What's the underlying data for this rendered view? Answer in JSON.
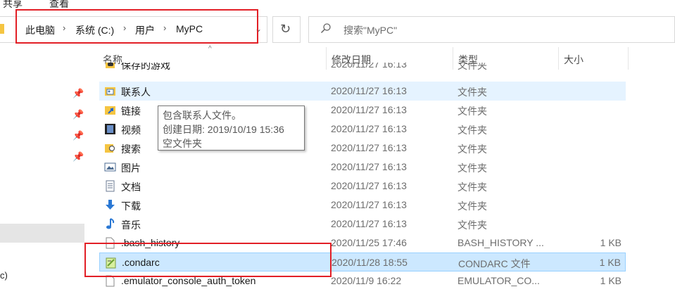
{
  "menu": {
    "items": [
      "共享",
      "查看"
    ]
  },
  "address": {
    "crumbs": [
      "此电脑",
      "系统 (C:)",
      "用户",
      "MyPC"
    ]
  },
  "search": {
    "placeholder": "搜索\"MyPC\""
  },
  "headers": {
    "name": "名称",
    "date": "修改日期",
    "type": "类型",
    "size": "大小"
  },
  "rows": [
    {
      "name": "保存的游戏",
      "date": "2020/11/27 16:13",
      "type": "文件夹",
      "size": "",
      "icon": "saved-games-icon"
    },
    {
      "name": "联系人",
      "date": "2020/11/27 16:13",
      "type": "文件夹",
      "size": "",
      "icon": "contacts-folder-icon"
    },
    {
      "name": "链接",
      "date": "2020/11/27 16:13",
      "type": "文件夹",
      "size": "",
      "icon": "links-folder-icon"
    },
    {
      "name": "视频",
      "date": "2020/11/27 16:13",
      "type": "文件夹",
      "size": "",
      "icon": "videos-folder-icon"
    },
    {
      "name": "搜索",
      "date": "2020/11/27 16:13",
      "type": "文件夹",
      "size": "",
      "icon": "searches-folder-icon"
    },
    {
      "name": "图片",
      "date": "2020/11/27 16:13",
      "type": "文件夹",
      "size": "",
      "icon": "pictures-folder-icon"
    },
    {
      "name": "文档",
      "date": "2020/11/27 16:13",
      "type": "文件夹",
      "size": "",
      "icon": "documents-folder-icon"
    },
    {
      "name": "下载",
      "date": "2020/11/27 16:13",
      "type": "文件夹",
      "size": "",
      "icon": "downloads-folder-icon"
    },
    {
      "name": "音乐",
      "date": "2020/11/27 16:13",
      "type": "文件夹",
      "size": "",
      "icon": "music-folder-icon"
    },
    {
      "name": ".bash_history",
      "date": "2020/11/25 17:46",
      "type": "BASH_HISTORY ...",
      "size": "1 KB",
      "icon": "file-icon"
    },
    {
      "name": ".condarc",
      "date": "2020/11/28 18:55",
      "type": "CONDARC 文件",
      "size": "1 KB",
      "icon": "notepad-file-icon"
    },
    {
      "name": ".emulator_console_auth_token",
      "date": "2020/11/9 16:22",
      "type": "EMULATOR_CO...",
      "size": "1 KB",
      "icon": "file-icon"
    }
  ],
  "tooltip": {
    "line1": "包含联系人文件。",
    "line2": "创建日期: 2019/10/19 15:36",
    "line3": "空文件夹"
  },
  "sidebar": {
    "partial_label": "c)"
  },
  "colors": {
    "selection": "#cce8ff",
    "hover": "#e5f3ff",
    "annotation": "#e21f26"
  }
}
